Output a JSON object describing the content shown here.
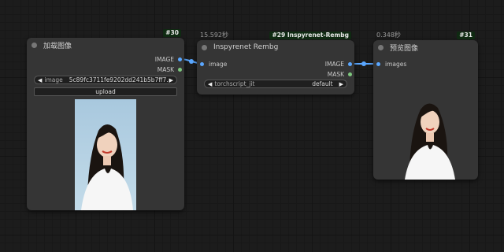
{
  "node_load": {
    "badge": "#30",
    "title": "加载图像",
    "outputs": [
      "IMAGE",
      "MASK"
    ],
    "image_widget": {
      "label": "image",
      "value": "5c89fc3711fe9202dd241b5b7ff7…"
    },
    "upload_label": "upload"
  },
  "node_rembg": {
    "time": "15.592秒",
    "badge": "#29 Inspyrenet-Rembg",
    "title": "Inspyrenet Rembg",
    "input": "image",
    "outputs": [
      "IMAGE",
      "MASK"
    ],
    "widget": {
      "label": "torchscript_jit",
      "value": "default"
    }
  },
  "node_preview": {
    "time": "0.348秒",
    "badge": "#31",
    "title": "预览图像",
    "input": "images"
  },
  "colors": {
    "canvas_bg": "#1c1c1c",
    "node_bg": "#353535",
    "link_blue": "#5aa7ff",
    "mask_green": "#7ec77e",
    "badge_bg": "#0f2a12"
  }
}
